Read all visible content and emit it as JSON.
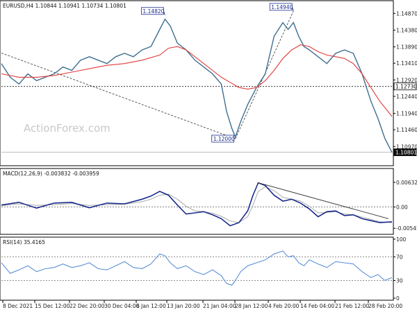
{
  "watermark": "ActionForex.com",
  "colors": {
    "price": "#3f6f8f",
    "ma": "#e03a3a",
    "macd": "#1a2b8c",
    "signal": "#a8a8a8",
    "rsi": "#5b8fd6",
    "trend": "#333333"
  },
  "chart_data": [
    {
      "type": "line",
      "title": "EURUSD,H4  1.10844 1.10941 1.10734 1.10801",
      "y_ticks": [
        "1.14870",
        "1.14380",
        "1.13890",
        "1.13410",
        "1.12920",
        "1.12440",
        "1.11940",
        "1.11460",
        "1.10970"
      ],
      "ylim": [
        1.1055,
        1.151
      ],
      "price_label": "1.12730",
      "horizontal_level": 1.1273,
      "current_label": "1.10801",
      "current_value": 1.10801,
      "annotations": [
        {
          "text": "1.14820",
          "x": 93,
          "y": 1.1482
        },
        {
          "text": "1.12000",
          "x": 133,
          "y": 1.112
        },
        {
          "text": "1.14940",
          "x": 166,
          "y": 1.1494
        }
      ],
      "trendlines": [
        {
          "points": [
            [
              0,
              1.1371
            ],
            [
              133,
              1.112
            ]
          ]
        },
        {
          "points": [
            [
              133,
              1.112
            ],
            [
              166,
              1.1494
            ]
          ]
        }
      ],
      "series": [
        {
          "role": "close",
          "x": [
            0,
            5,
            10,
            15,
            20,
            25,
            30,
            35,
            40,
            45,
            50,
            55,
            60,
            65,
            70,
            75,
            80,
            85,
            90,
            93,
            96,
            100,
            105,
            110,
            115,
            120,
            125,
            128,
            131,
            133,
            136,
            140,
            145,
            150,
            155,
            160,
            163,
            166,
            169,
            172,
            175,
            180,
            185,
            190,
            195,
            200,
            205,
            210,
            214,
            218,
            222
          ],
          "values": [
            1.134,
            1.13,
            1.128,
            1.131,
            1.129,
            1.13,
            1.131,
            1.133,
            1.132,
            1.135,
            1.136,
            1.135,
            1.134,
            1.136,
            1.137,
            1.136,
            1.138,
            1.139,
            1.144,
            1.147,
            1.145,
            1.14,
            1.138,
            1.135,
            1.133,
            1.131,
            1.128,
            1.12,
            1.115,
            1.1125,
            1.117,
            1.122,
            1.127,
            1.131,
            1.142,
            1.146,
            1.144,
            1.146,
            1.142,
            1.139,
            1.138,
            1.136,
            1.134,
            1.137,
            1.138,
            1.137,
            1.131,
            1.123,
            1.118,
            1.112,
            1.108
          ]
        },
        {
          "role": "moving_average",
          "x": [
            0,
            10,
            20,
            30,
            40,
            50,
            60,
            70,
            80,
            90,
            95,
            100,
            105,
            110,
            115,
            120,
            125,
            130,
            135,
            140,
            145,
            150,
            155,
            160,
            165,
            170,
            175,
            180,
            185,
            190,
            195,
            200,
            205,
            210,
            215,
            222
          ],
          "values": [
            1.131,
            1.13,
            1.13,
            1.1305,
            1.1315,
            1.1325,
            1.1335,
            1.134,
            1.135,
            1.1365,
            1.1385,
            1.139,
            1.138,
            1.136,
            1.134,
            1.132,
            1.13,
            1.1285,
            1.127,
            1.1265,
            1.127,
            1.129,
            1.132,
            1.1355,
            1.138,
            1.1395,
            1.139,
            1.1375,
            1.1365,
            1.136,
            1.1355,
            1.134,
            1.131,
            1.127,
            1.123,
            1.1185
          ]
        }
      ]
    },
    {
      "type": "line",
      "title": "MACD(12,26,9) -0.003832 -0.003959",
      "y_ticks": [
        "0.00632",
        "0.00",
        "-0.005455"
      ],
      "ylim": [
        -0.0063,
        0.0072
      ],
      "trendlines": [
        {
          "points": [
            [
              146,
              0.0062
            ],
            [
              220,
              -0.003
            ]
          ]
        }
      ],
      "series": [
        {
          "role": "macd",
          "x": [
            0,
            10,
            20,
            30,
            40,
            50,
            60,
            70,
            80,
            85,
            90,
            95,
            100,
            105,
            110,
            115,
            120,
            125,
            130,
            135,
            140,
            143,
            146,
            150,
            155,
            160,
            165,
            170,
            175,
            180,
            185,
            190,
            195,
            200,
            205,
            210,
            215,
            222
          ],
          "values": [
            0.0005,
            0.0012,
            -0.0003,
            0.001,
            0.0012,
            -0.0002,
            0.001,
            0.0008,
            0.002,
            0.0028,
            0.004,
            0.003,
            0.0005,
            -0.0018,
            -0.0015,
            -0.0012,
            -0.002,
            -0.003,
            -0.0048,
            -0.004,
            -0.001,
            0.003,
            0.0062,
            0.0055,
            0.003,
            0.0015,
            0.002,
            0.001,
            -0.0005,
            -0.0025,
            -0.0012,
            -0.001,
            -0.0022,
            -0.002,
            -0.003,
            -0.0035,
            -0.004,
            -0.0038
          ]
        },
        {
          "role": "signal",
          "x": [
            0,
            10,
            20,
            30,
            40,
            50,
            60,
            70,
            80,
            85,
            90,
            95,
            100,
            105,
            110,
            115,
            120,
            125,
            130,
            135,
            140,
            143,
            146,
            150,
            155,
            160,
            165,
            170,
            175,
            180,
            185,
            190,
            195,
            200,
            205,
            210,
            215,
            222
          ],
          "values": [
            0.0003,
            0.0008,
            0.0004,
            0.0006,
            0.0009,
            0.0004,
            0.0006,
            0.0007,
            0.0014,
            0.002,
            0.003,
            0.0033,
            0.002,
            0.0002,
            -0.001,
            -0.0012,
            -0.0016,
            -0.0024,
            -0.0036,
            -0.004,
            -0.0025,
            0.0005,
            0.004,
            0.0052,
            0.0042,
            0.0025,
            0.002,
            0.0015,
            0.0002,
            -0.0015,
            -0.0014,
            -0.0012,
            -0.0018,
            -0.002,
            -0.0026,
            -0.0032,
            -0.0038,
            -0.004
          ]
        }
      ]
    },
    {
      "type": "line",
      "title": "RSI(14) 35.4165",
      "y_ticks": [
        "100",
        "70",
        "30",
        "0"
      ],
      "ylim": [
        0,
        100
      ],
      "levels": [
        70,
        30
      ],
      "series": [
        {
          "role": "rsi",
          "x": [
            0,
            5,
            10,
            15,
            20,
            25,
            30,
            35,
            40,
            45,
            50,
            55,
            60,
            65,
            70,
            75,
            80,
            85,
            90,
            93,
            96,
            100,
            105,
            110,
            115,
            120,
            125,
            128,
            131,
            133,
            136,
            140,
            145,
            150,
            155,
            160,
            163,
            166,
            169,
            172,
            175,
            180,
            185,
            190,
            195,
            200,
            205,
            210,
            214,
            218,
            222
          ],
          "values": [
            60,
            42,
            48,
            55,
            45,
            50,
            52,
            58,
            52,
            55,
            60,
            50,
            48,
            55,
            62,
            52,
            50,
            58,
            75,
            72,
            60,
            50,
            55,
            45,
            40,
            48,
            38,
            25,
            22,
            30,
            45,
            55,
            60,
            65,
            75,
            80,
            70,
            72,
            60,
            55,
            65,
            58,
            52,
            62,
            60,
            58,
            45,
            35,
            40,
            30,
            35
          ]
        }
      ]
    }
  ],
  "x_axis": {
    "labels": [
      {
        "text": "8 Dec 2021",
        "x": 4
      },
      {
        "text": "15 Dec 12:00",
        "x": 30
      },
      {
        "text": "22 Dec 20:00",
        "x": 56
      },
      {
        "text": "30 Dec 04:00",
        "x": 80
      },
      {
        "text": "6 Jan 12:00",
        "x": 105
      },
      {
        "text": "13 Jan 20:00",
        "x": 128
      },
      {
        "text": "21 Jan 04:00",
        "x": 152
      },
      {
        "text": "28 Jan 12:00",
        "x": 176
      },
      {
        "text": "4 Feb 20:00",
        "x": 198
      },
      {
        "text": "14 Feb 04:00",
        "x": 220
      },
      {
        "text": "21 Feb 12:00",
        "x": 242
      },
      {
        "text": "28 Feb 20:00",
        "x": 262
      }
    ],
    "xlim": [
      0,
      222
    ]
  }
}
